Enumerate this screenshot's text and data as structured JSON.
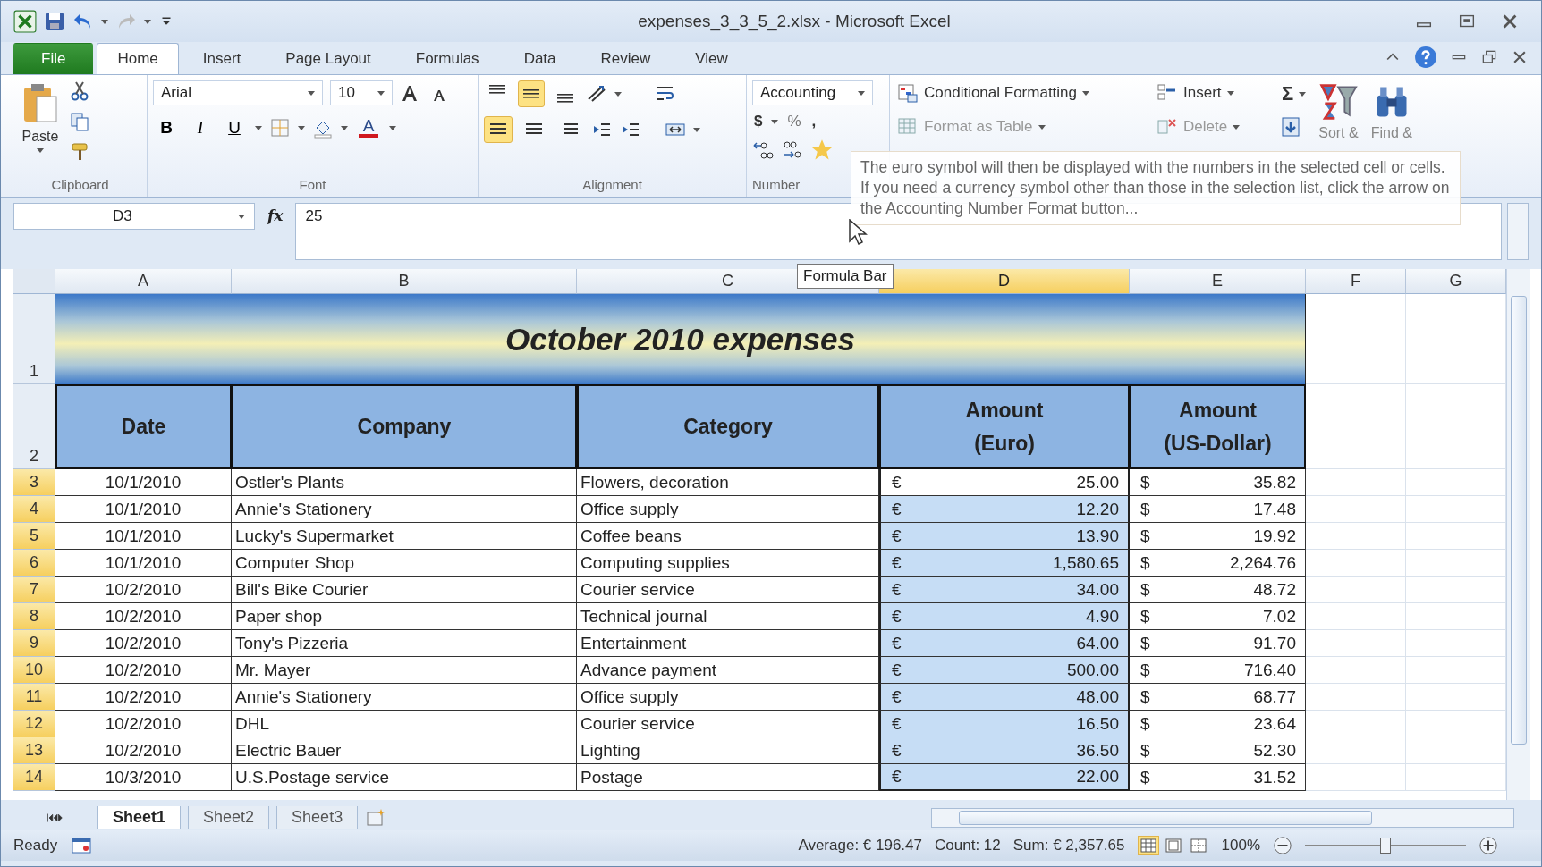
{
  "window": {
    "title": "expenses_3_3_5_2.xlsx - Microsoft Excel"
  },
  "ribbon_tabs": [
    {
      "label": "File",
      "kind": "file",
      "selected": false
    },
    {
      "label": "Home",
      "kind": "tab",
      "selected": true
    },
    {
      "label": "Insert",
      "kind": "tab",
      "selected": false
    },
    {
      "label": "Page Layout",
      "kind": "tab",
      "selected": false
    },
    {
      "label": "Formulas",
      "kind": "tab",
      "selected": false
    },
    {
      "label": "Data",
      "kind": "tab",
      "selected": false
    },
    {
      "label": "Review",
      "kind": "tab",
      "selected": false
    },
    {
      "label": "View",
      "kind": "tab",
      "selected": false
    }
  ],
  "clipboard": {
    "paste": "Paste",
    "label": "Clipboard"
  },
  "font": {
    "name": "Arial",
    "size": "10",
    "bold": "B",
    "italic": "I",
    "underline": "U",
    "color_letter": "A",
    "label": "Font"
  },
  "alignment": {
    "label": "Alignment",
    "vertical": [
      {
        "selected": false
      },
      {
        "selected": true
      },
      {
        "selected": false
      }
    ],
    "horizontal": [
      {
        "selected": true
      },
      {
        "selected": false
      },
      {
        "selected": false
      }
    ]
  },
  "number": {
    "format": "Accounting",
    "currency": "$",
    "percent": "%",
    "comma": ",",
    "label": "Number"
  },
  "styles": {
    "conditional": "Conditional Formatting",
    "format_table": "Format as Table"
  },
  "cells": {
    "insert": "Insert",
    "delete": "Delete"
  },
  "editing": {
    "sum": "Σ",
    "sort": "Sort &",
    "find": "Find &"
  },
  "screen_tip": {
    "text": "The euro symbol will then be displayed with the numbers in the selected cell or cells. If you need a currency symbol other than those in the selection list, click the arrow on the Accounting Number Format button..."
  },
  "formula_bar": {
    "name_box": "D3",
    "fx": "fx",
    "value": "25",
    "tooltip": "Formula Bar"
  },
  "columns": [
    {
      "label": "A",
      "selected": false
    },
    {
      "label": "B",
      "selected": false
    },
    {
      "label": "C",
      "selected": false
    },
    {
      "label": "D",
      "selected": true
    },
    {
      "label": "E",
      "selected": false
    },
    {
      "label": "F",
      "selected": false
    },
    {
      "label": "G",
      "selected": false
    }
  ],
  "title_row": {
    "number": "1",
    "title": "October 2010 expenses"
  },
  "header_row": {
    "number": "2",
    "cells": [
      "Date",
      "Company",
      "Category",
      "Amount\n(Euro)",
      "Amount\n(US-Dollar)"
    ]
  },
  "rows": [
    {
      "number": "3",
      "selected": true,
      "active": true,
      "date": "10/1/2010",
      "company": "Ostler's Plants",
      "category": "Flowers, decoration",
      "eur_symbol": "€",
      "eur": "25.00",
      "usd_symbol": "$",
      "usd": "35.82"
    },
    {
      "number": "4",
      "selected": true,
      "active": false,
      "date": "10/1/2010",
      "company": "Annie's Stationery",
      "category": "Office supply",
      "eur_symbol": "€",
      "eur": "12.20",
      "usd_symbol": "$",
      "usd": "17.48"
    },
    {
      "number": "5",
      "selected": true,
      "active": false,
      "date": "10/1/2010",
      "company": "Lucky's Supermarket",
      "category": "Coffee beans",
      "eur_symbol": "€",
      "eur": "13.90",
      "usd_symbol": "$",
      "usd": "19.92"
    },
    {
      "number": "6",
      "selected": true,
      "active": false,
      "date": "10/1/2010",
      "company": "Computer Shop",
      "category": "Computing supplies",
      "eur_symbol": "€",
      "eur": "1,580.65",
      "usd_symbol": "$",
      "usd": "2,264.76"
    },
    {
      "number": "7",
      "selected": true,
      "active": false,
      "date": "10/2/2010",
      "company": "Bill's Bike Courier",
      "category": "Courier service",
      "eur_symbol": "€",
      "eur": "34.00",
      "usd_symbol": "$",
      "usd": "48.72"
    },
    {
      "number": "8",
      "selected": true,
      "active": false,
      "date": "10/2/2010",
      "company": "Paper shop",
      "category": "Technical journal",
      "eur_symbol": "€",
      "eur": "4.90",
      "usd_symbol": "$",
      "usd": "7.02"
    },
    {
      "number": "9",
      "selected": true,
      "active": false,
      "date": "10/2/2010",
      "company": "Tony's Pizzeria",
      "category": "Entertainment",
      "eur_symbol": "€",
      "eur": "64.00",
      "usd_symbol": "$",
      "usd": "91.70"
    },
    {
      "number": "10",
      "selected": true,
      "active": false,
      "date": "10/2/2010",
      "company": "Mr. Mayer",
      "category": "Advance payment",
      "eur_symbol": "€",
      "eur": "500.00",
      "usd_symbol": "$",
      "usd": "716.40"
    },
    {
      "number": "11",
      "selected": true,
      "active": false,
      "date": "10/2/2010",
      "company": "Annie's Stationery",
      "category": "Office supply",
      "eur_symbol": "€",
      "eur": "48.00",
      "usd_symbol": "$",
      "usd": "68.77"
    },
    {
      "number": "12",
      "selected": true,
      "active": false,
      "date": "10/2/2010",
      "company": "DHL",
      "category": "Courier service",
      "eur_symbol": "€",
      "eur": "16.50",
      "usd_symbol": "$",
      "usd": "23.64"
    },
    {
      "number": "13",
      "selected": true,
      "active": false,
      "date": "10/2/2010",
      "company": "Electric Bauer",
      "category": "Lighting",
      "eur_symbol": "€",
      "eur": "36.50",
      "usd_symbol": "$",
      "usd": "52.30"
    },
    {
      "number": "14",
      "selected": true,
      "active": false,
      "date": "10/3/2010",
      "company": "U.S.Postage service",
      "category": "Postage",
      "eur_symbol": "€",
      "eur": "22.00",
      "usd_symbol": "$",
      "usd": "31.52"
    }
  ],
  "sheet_tabs": [
    {
      "label": "Sheet1",
      "selected": true
    },
    {
      "label": "Sheet2",
      "selected": false
    },
    {
      "label": "Sheet3",
      "selected": false
    }
  ],
  "status_bar": {
    "mode": "Ready",
    "average": "Average: € 196.47",
    "count": "Count: 12",
    "sum": "Sum: € 2,357.65",
    "views": [
      {
        "selected": true
      },
      {
        "selected": false
      },
      {
        "selected": false
      }
    ],
    "zoom": "100%",
    "zoom_slider": {
      "level": 0.5
    }
  }
}
